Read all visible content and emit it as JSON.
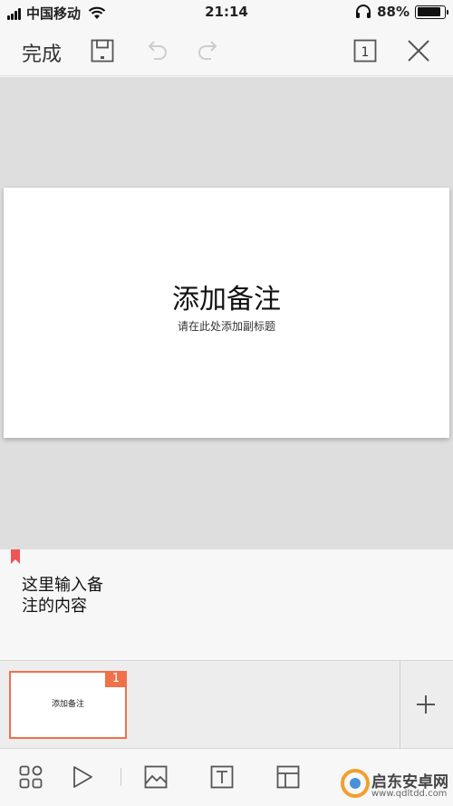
{
  "status_bar": {
    "carrier": "中国移动",
    "time": "21:14",
    "battery_percent": "88%",
    "battery_level": 0.88
  },
  "toolbar": {
    "done_label": "完成",
    "icons": [
      "save-icon",
      "undo-icon",
      "redo-icon",
      "slide-count-icon",
      "close-icon"
    ],
    "slide_count": "1"
  },
  "slide": {
    "title": "添加备注",
    "subtitle": "请在此处添加副标题"
  },
  "notes": {
    "text_line1": "这里输入备",
    "text_line2": "注的内容",
    "marker_color": "#f05454"
  },
  "thumbnails": {
    "items": [
      {
        "number": "1",
        "title": "添加备注"
      }
    ],
    "accent": "#f0704a"
  },
  "bottom_bar": {
    "icons": [
      "slides-grid-icon",
      "play-icon",
      "image-icon",
      "text-box-icon",
      "layout-icon"
    ]
  },
  "watermark": {
    "name": "启东安卓网",
    "url": "www.qdltdd.com"
  }
}
